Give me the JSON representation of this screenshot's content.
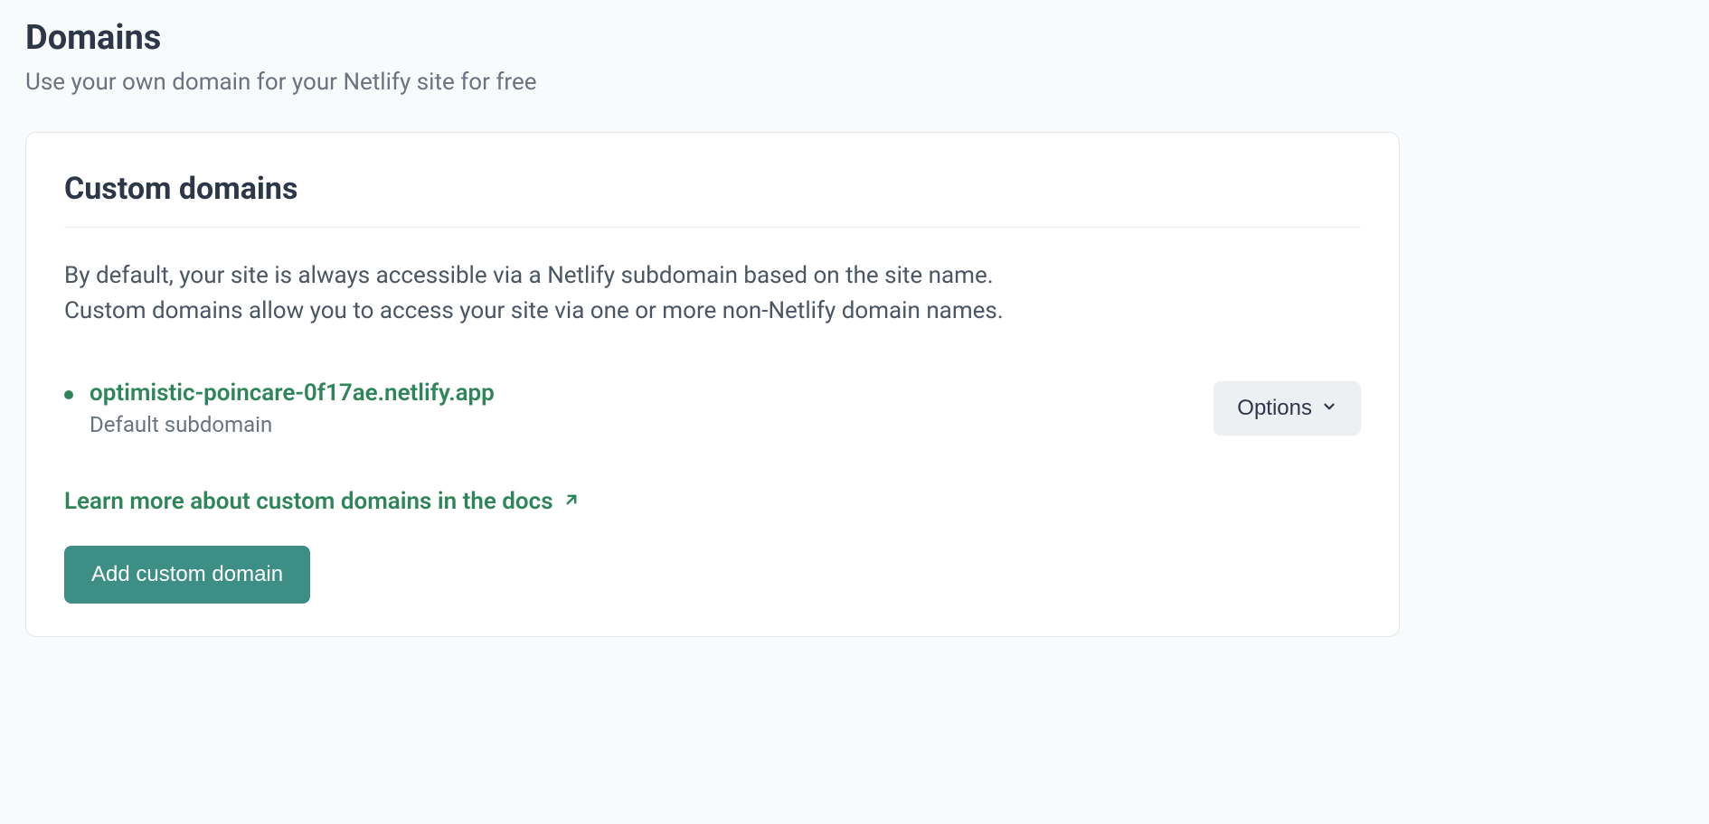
{
  "header": {
    "title": "Domains",
    "subtitle": "Use your own domain for your Netlify site for free"
  },
  "card": {
    "heading": "Custom domains",
    "description": "By default, your site is always accessible via a Netlify subdomain based on the site name. Custom domains allow you to access your site via one or more non-Netlify domain names.",
    "domain": {
      "url": "optimistic-poincare-0f17ae.netlify.app",
      "label": "Default subdomain"
    },
    "options_label": "Options",
    "docs_link": "Learn more about custom domains in the docs",
    "add_button": "Add custom domain"
  }
}
